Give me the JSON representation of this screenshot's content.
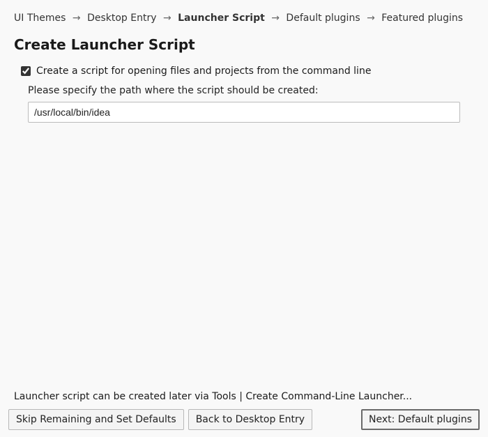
{
  "breadcrumb": {
    "items": [
      {
        "label": "UI Themes",
        "current": false
      },
      {
        "label": "Desktop Entry",
        "current": false
      },
      {
        "label": "Launcher Script",
        "current": true
      },
      {
        "label": "Default plugins",
        "current": false
      },
      {
        "label": "Featured plugins",
        "current": false
      }
    ],
    "separator": "→"
  },
  "title": "Create Launcher Script",
  "checkbox": {
    "label": "Create a script for opening files and projects from the command line",
    "checked": true
  },
  "path": {
    "label": "Please specify the path where the script should be created:",
    "value": "/usr/local/bin/idea"
  },
  "hint": "Launcher script can be created later via Tools | Create Command-Line Launcher...",
  "buttons": {
    "skip": "Skip Remaining and Set Defaults",
    "back": "Back to Desktop Entry",
    "next": "Next: Default plugins"
  }
}
